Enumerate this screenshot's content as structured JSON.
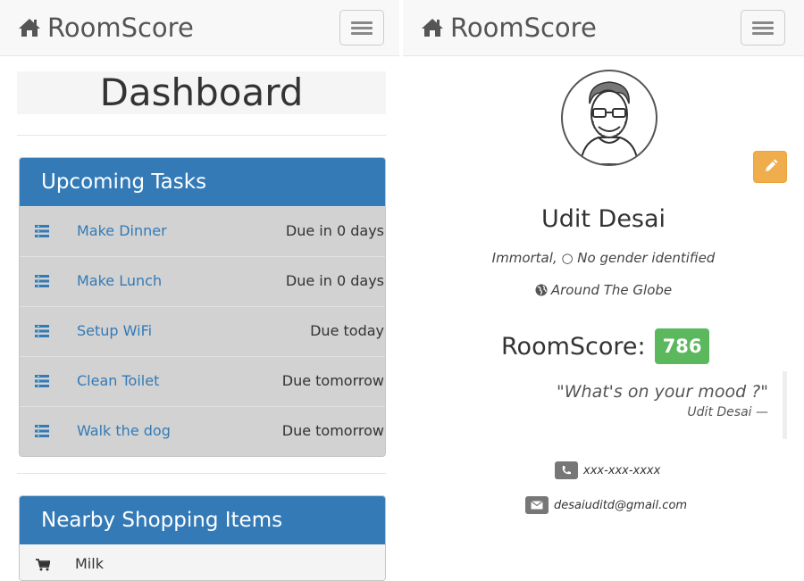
{
  "left": {
    "brand": "RoomScore",
    "title": "Dashboard",
    "tasks_heading": "Upcoming Tasks",
    "tasks": [
      {
        "name": "Make Dinner",
        "due": "Due in 0 days"
      },
      {
        "name": "Make Lunch",
        "due": "Due in 0 days"
      },
      {
        "name": "Setup WiFi",
        "due": "Due today"
      },
      {
        "name": "Clean Toilet",
        "due": "Due tomorrow"
      },
      {
        "name": "Walk the dog",
        "due": "Due tomorrow"
      }
    ],
    "shopping_heading": "Nearby Shopping Items",
    "shopping": [
      {
        "name": "Milk"
      }
    ]
  },
  "right": {
    "brand": "RoomScore",
    "profile": {
      "name": "Udit Desai",
      "meta": "Immortal, ○ No gender identified",
      "location": "Around The Globe",
      "score_label": "RoomScore:",
      "score": "786",
      "quote": "\"What's on your mood ?\"",
      "quote_author": "Udit Desai —",
      "phone": "xxx-xxx-xxxx",
      "email": "desaiuditd@gmail.com"
    }
  },
  "colors": {
    "primary": "#337ab7",
    "score_badge": "#5cb85c",
    "edit_button": "#f0ad4e"
  },
  "icons": [
    "home-icon",
    "menu-icon",
    "list-icon",
    "cart-icon",
    "pencil-icon",
    "globe-icon",
    "phone-icon",
    "envelope-icon"
  ]
}
